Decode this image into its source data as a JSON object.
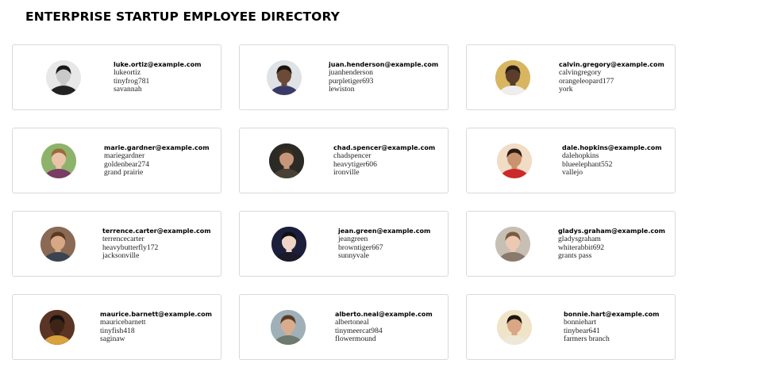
{
  "title": "ENTERPRISE STARTUP EMPLOYEE DIRECTORY",
  "employees": [
    {
      "email": "luke.ortiz@example.com",
      "username": "lukeortiz",
      "password": "tinyfrog781",
      "city": "savannah",
      "avatar": {
        "bg": "#e8e8e8",
        "skin": "#c9c9c9",
        "hair": "#1a1a1a",
        "shirt": "#222222"
      }
    },
    {
      "email": "juan.henderson@example.com",
      "username": "juanhenderson",
      "password": "purpletiger693",
      "city": "lewiston",
      "avatar": {
        "bg": "#dfe3e6",
        "skin": "#6b4a36",
        "hair": "#1c140f",
        "shirt": "#3b3a66"
      }
    },
    {
      "email": "calvin.gregory@example.com",
      "username": "calvingregory",
      "password": "orangeleopard177",
      "city": "york",
      "avatar": {
        "bg": "#d8b560",
        "skin": "#5a3d2a",
        "hair": "#2a1c14",
        "shirt": "#eeeeee"
      }
    },
    {
      "email": "marie.gardner@example.com",
      "username": "mariegardner",
      "password": "goldenbear274",
      "city": "grand prairie",
      "avatar": {
        "bg": "#8db36a",
        "skin": "#e9c4a8",
        "hair": "#9a6a3c",
        "shirt": "#7a3b64"
      }
    },
    {
      "email": "chad.spencer@example.com",
      "username": "chadspencer",
      "password": "heavytiger606",
      "city": "ironville",
      "avatar": {
        "bg": "#2c2a25",
        "skin": "#c7957a",
        "hair": "#3a2e22",
        "shirt": "#4a4136"
      }
    },
    {
      "email": "dale.hopkins@example.com",
      "username": "dalehopkins",
      "password": "blueelephant552",
      "city": "vallejo",
      "avatar": {
        "bg": "#f1dcc6",
        "skin": "#c9936d",
        "hair": "#2b1d14",
        "shirt": "#cc2a2a"
      }
    },
    {
      "email": "terrence.carter@example.com",
      "username": "terrencecarter",
      "password": "heavybutterfly172",
      "city": "jacksonville",
      "avatar": {
        "bg": "#8a6a55",
        "skin": "#d8a884",
        "hair": "#5a3a24",
        "shirt": "#3a4450"
      }
    },
    {
      "email": "jean.green@example.com",
      "username": "jeangreen",
      "password": "browntiger667",
      "city": "sunnyvale",
      "avatar": {
        "bg": "#1c1f3c",
        "skin": "#efd5c6",
        "hair": "#101010",
        "shirt": "#1a1a2a"
      }
    },
    {
      "email": "gladys.graham@example.com",
      "username": "gladysgraham",
      "password": "whiterabbit692",
      "city": "grants pass",
      "avatar": {
        "bg": "#c8bfb4",
        "skin": "#ecc9b3",
        "hair": "#7c5a3e",
        "shirt": "#8a7a6c"
      }
    },
    {
      "email": "maurice.barnett@example.com",
      "username": "mauricebarnett",
      "password": "tinyfish418",
      "city": "saginaw",
      "avatar": {
        "bg": "#5a3424",
        "skin": "#3e2416",
        "hair": "#161010",
        "shirt": "#d9a23c"
      }
    },
    {
      "email": "alberto.neal@example.com",
      "username": "albertoneal",
      "password": "tinymeercat984",
      "city": "flowermound",
      "avatar": {
        "bg": "#9fb0b8",
        "skin": "#d8ad8e",
        "hair": "#5a3b26",
        "shirt": "#6d7a70"
      }
    },
    {
      "email": "bonnie.hart@example.com",
      "username": "bonniehart",
      "password": "tinybear641",
      "city": "farmers branch",
      "avatar": {
        "bg": "#f0e4c8",
        "skin": "#d9a783",
        "hair": "#1d1611",
        "shirt": "#efe7d8"
      }
    }
  ]
}
